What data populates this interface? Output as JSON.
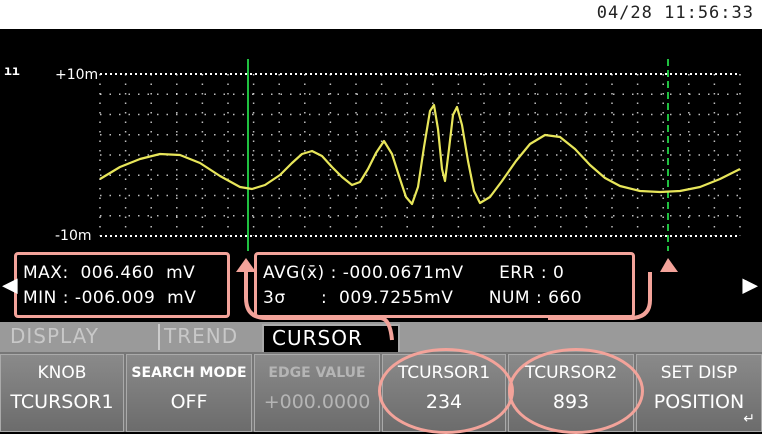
{
  "header": {
    "datetime": "04/28 11:56:33"
  },
  "plot": {
    "y_top_label": "+10m",
    "y_bottom_label": "-10m",
    "trace_color": "#e8e65a",
    "cursor_color": "#20c040",
    "grid_color": "#ffffff"
  },
  "stats_left": {
    "max_line": "MAX:  006.460  mV",
    "min_line": "MIN : -006.009  mV"
  },
  "stats_right": {
    "avg_line": "AVG(x̄) : -000.0671mV      ERR : 0",
    "sigma_line": "3σ      :  009.7255mV      NUM : 660"
  },
  "tabs": [
    {
      "label": "DISPLAY"
    },
    {
      "label": "TREND"
    },
    {
      "label": "CURSOR"
    }
  ],
  "softkeys": {
    "knob": {
      "line1": "KNOB",
      "line2": "TCURSOR1"
    },
    "search": {
      "line1": "SEARCH MODE",
      "line2": "OFF"
    },
    "edge": {
      "line1": "EDGE VALUE",
      "line2": "+000.0000"
    },
    "tcursor1": {
      "line1": "TCURSOR1",
      "line2": "234"
    },
    "tcursor2": {
      "line1": "TCURSOR2",
      "line2": "893"
    },
    "setdisp": {
      "line1": "SET DISP",
      "line2": "POSITION"
    }
  },
  "icons": {
    "left_arrow": "triangle-left",
    "right_arrow": "triangle-right",
    "corner": "corner-arrow"
  }
}
